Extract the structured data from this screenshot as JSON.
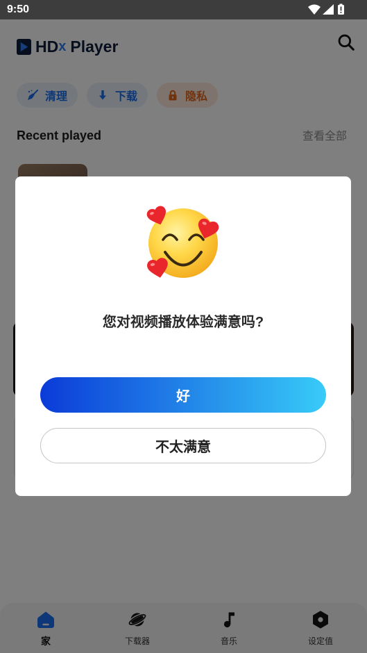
{
  "status_bar": {
    "time": "9:50",
    "icons": [
      "wifi-icon",
      "signal-icon",
      "battery-icon"
    ]
  },
  "app": {
    "brand": {
      "hd": "HD",
      "x": "x",
      "player": "Player",
      "icon": "play-logo-icon"
    },
    "search_icon": "search-icon",
    "chips": [
      {
        "label": "清理",
        "icon": "broom-icon"
      },
      {
        "label": "下载",
        "icon": "download-arrow-icon"
      },
      {
        "label": "隐私",
        "icon": "lock-icon"
      }
    ],
    "recent": {
      "title": "Recent played",
      "view_all": "查看全部"
    }
  },
  "dialog": {
    "icon": "smiling-face-with-hearts-icon",
    "question": "您对视频播放体验满意吗?",
    "positive_button": "好",
    "negative_button": "不太满意"
  },
  "bottom_nav": {
    "items": [
      {
        "label": "家",
        "icon": "home-icon",
        "active": true
      },
      {
        "label": "下载器",
        "icon": "planet-icon",
        "active": false
      },
      {
        "label": "音乐",
        "icon": "music-note-icon",
        "active": false
      },
      {
        "label": "设定值",
        "icon": "settings-hexagon-icon",
        "active": false
      }
    ]
  },
  "colors": {
    "accent": "#1a6fec",
    "gradient_start": "#0b3bd8",
    "gradient_end": "#38cbf8",
    "privacy": "#e2661a",
    "brand_navy": "#0e1f3d",
    "status_bar": "#3d3d3d"
  }
}
